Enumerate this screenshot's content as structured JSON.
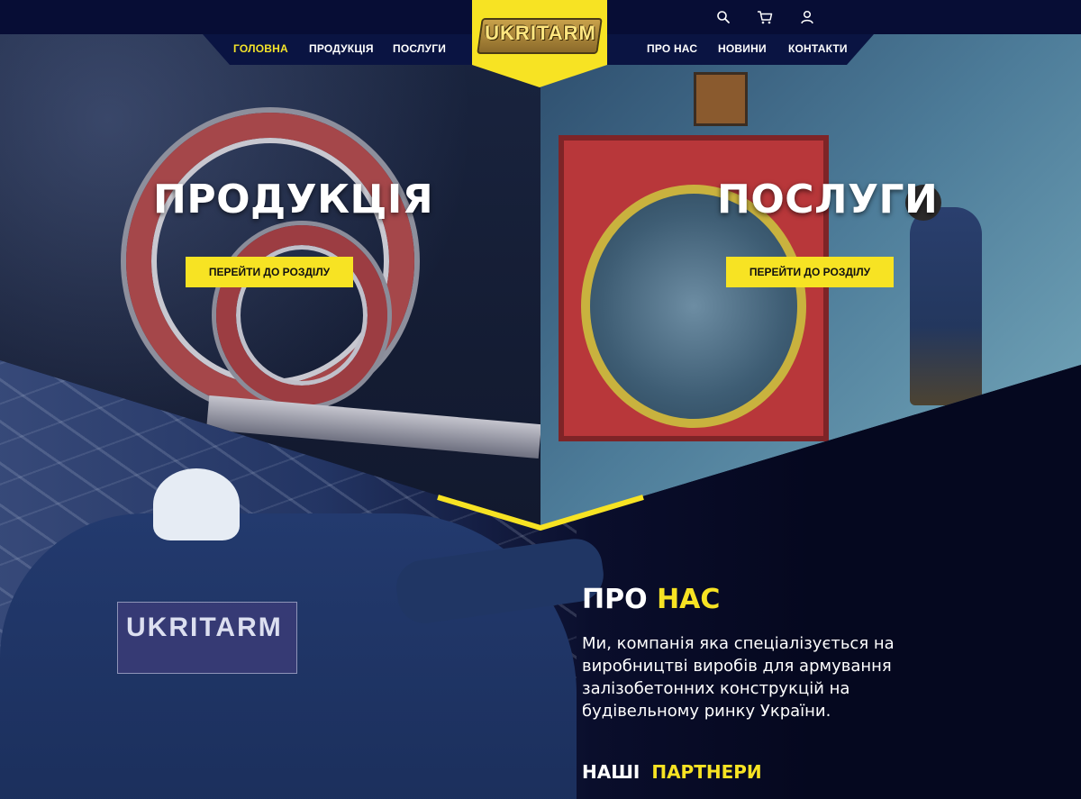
{
  "brand": {
    "logo_text": "UKRITARM",
    "accent_color": "#f7e323",
    "header_color": "#070d35"
  },
  "nav": {
    "left": [
      {
        "label": "Головна",
        "active": true
      },
      {
        "label": "Продукція",
        "active": false
      },
      {
        "label": "Послуги",
        "active": false
      }
    ],
    "right": [
      {
        "label": "Про нас",
        "active": false
      },
      {
        "label": "Новини",
        "active": false
      },
      {
        "label": "Контакти",
        "active": false
      }
    ]
  },
  "header_icons": [
    "search-icon",
    "cart-icon",
    "user-icon"
  ],
  "hero": {
    "products": {
      "title": "Продукція",
      "button": "Перейти до розділу"
    },
    "services": {
      "title": "Послуги",
      "button": "Перейти до розділу"
    }
  },
  "jacket_patch": "UKRITARM",
  "about": {
    "heading_plain": "ПРО",
    "heading_accent": "НАС",
    "text": "Ми, компанія яка спеціалізується на виробництві виробів для армування залізобетонних конструкцій на будівельному ринку України."
  },
  "partners": {
    "heading_plain": "НАШІ",
    "heading_accent": "ПАРТНЕРИ"
  }
}
